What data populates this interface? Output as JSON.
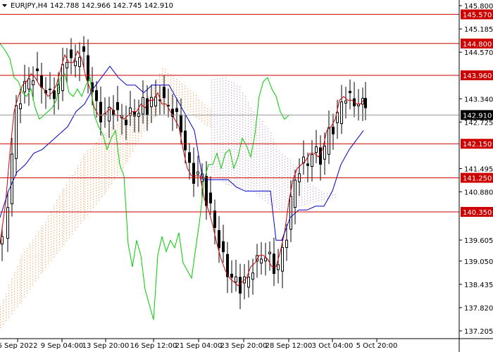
{
  "header": {
    "symbol": "EURJPY,H4",
    "ohlc": "142.788 142.966 142.745 142.910"
  },
  "chart_data": {
    "type": "candlestick",
    "symbol": "EURJPY",
    "timeframe": "H4",
    "open": 142.788,
    "high": 142.966,
    "low": 142.745,
    "close": 142.91,
    "current_price": 142.91,
    "ylim": [
      137.0,
      145.95
    ],
    "y_ticks": [
      "145.800",
      "145.185",
      "144.570",
      "143.340",
      "142.725",
      "141.495",
      "140.880",
      "139.605",
      "139.050",
      "138.435",
      "137.820",
      "137.205"
    ],
    "x_ticks": [
      "6 Sep 2022",
      "9 Sep 04:00",
      "13 Sep 20:00",
      "16 Sep 12:00",
      "21 Sep 04:00",
      "23 Sep 20:00",
      "28 Sep 12:00",
      "3 Oct 04:00",
      "5 Oct 20:00"
    ],
    "levels": [
      145.57,
      144.8,
      143.96,
      142.15,
      141.25,
      140.35
    ],
    "level_labels": [
      "145.570",
      "144.800",
      "143.960",
      "142.150",
      "141.250",
      "140.350"
    ],
    "price_label": "142.910",
    "colors": {
      "level_line": "#cc0000",
      "level_label_bg": "#cc0000",
      "price_label_bg": "#000000",
      "candle": "#000000",
      "tenkan": "#cc0000",
      "kijun": "#0000cc",
      "chikou": "#00cc00",
      "cloud_bull": "#f4a460",
      "cloud_bear": "#c8a2c8"
    },
    "series": [
      {
        "name": "tenkan",
        "x": [
          0,
          8,
          14,
          20,
          26,
          32,
          38,
          44,
          50,
          56,
          62,
          68,
          74,
          80,
          86,
          92,
          98,
          104,
          110,
          116,
          122,
          128,
          134,
          140,
          146,
          152,
          158,
          164,
          170,
          176,
          182,
          188,
          194,
          200,
          206,
          212,
          218,
          224,
          230,
          236,
          242,
          248,
          254,
          260,
          266,
          272,
          278,
          284,
          290,
          296,
          302,
          308,
          314,
          320,
          326,
          332,
          338,
          344,
          350,
          356,
          362,
          368,
          374,
          380,
          386,
          392,
          398,
          404,
          410,
          416,
          422,
          428,
          434,
          440,
          446,
          452,
          458,
          464,
          470,
          476,
          482,
          488,
          494,
          500,
          506,
          512,
          516
        ],
        "y": [
          139.5,
          140.6,
          141.9,
          143.0,
          143.4,
          143.7,
          143.8,
          144.0,
          143.9,
          143.7,
          143.6,
          143.4,
          143.5,
          143.7,
          144.1,
          144.5,
          144.3,
          144.3,
          144.6,
          144.4,
          143.9,
          143.6,
          143.1,
          142.9,
          142.9,
          143.0,
          143.1,
          142.9,
          142.9,
          142.8,
          142.9,
          143.0,
          143.0,
          143.2,
          143.1,
          143.3,
          143.3,
          143.5,
          143.2,
          143.2,
          143.0,
          142.8,
          142.6,
          142.0,
          141.5,
          141.3,
          141.3,
          141.3,
          140.7,
          140.4,
          140.0,
          139.5,
          139.1,
          138.8,
          138.6,
          138.5,
          138.4,
          138.5,
          138.6,
          138.9,
          139.0,
          139.2,
          139.2,
          139.1,
          138.9,
          138.9,
          139.3,
          139.8,
          140.6,
          141.2,
          141.5,
          141.6,
          141.7,
          141.9,
          141.9,
          141.8,
          142.0,
          142.5,
          142.6,
          142.8,
          143.3,
          143.4,
          143.3,
          143.3,
          143.2,
          143.2,
          143.3
        ]
      },
      {
        "name": "kijun",
        "x": [
          0,
          12,
          24,
          36,
          48,
          60,
          72,
          84,
          96,
          108,
          120,
          132,
          144,
          156,
          168,
          180,
          192,
          204,
          216,
          228,
          240,
          252,
          264,
          276,
          288,
          300,
          312,
          324,
          336,
          348,
          360,
          372,
          384,
          392,
          400,
          412,
          424,
          436,
          448,
          460,
          472,
          484,
          496,
          508,
          516
        ],
        "y": [
          140.2,
          140.9,
          141.4,
          141.6,
          141.9,
          142.0,
          142.2,
          142.4,
          142.6,
          143.0,
          143.2,
          143.6,
          143.9,
          144.2,
          143.9,
          143.7,
          143.7,
          143.5,
          143.7,
          143.7,
          143.7,
          143.3,
          142.9,
          142.5,
          141.2,
          141.2,
          141.2,
          141.2,
          141.0,
          140.9,
          140.9,
          140.9,
          140.9,
          139.6,
          139.6,
          140.2,
          140.4,
          140.4,
          140.5,
          140.5,
          140.9,
          141.6,
          142.0,
          142.3,
          142.5
        ]
      },
      {
        "name": "chikou",
        "x": [
          0,
          8,
          14,
          20,
          26,
          32,
          38,
          44,
          50,
          56,
          62,
          68,
          74,
          80,
          86,
          92,
          98,
          104,
          110,
          116,
          122,
          128,
          134,
          140,
          146,
          152,
          158,
          164,
          170,
          176,
          182,
          188,
          194,
          200,
          206,
          212,
          218,
          224,
          230,
          236,
          242,
          248,
          254,
          260,
          266,
          272,
          278,
          284,
          290,
          296,
          302,
          308,
          314,
          320,
          326,
          332,
          338,
          344,
          350,
          356,
          362,
          368,
          374,
          380,
          386,
          392,
          398,
          404,
          410
        ],
        "y": [
          144.8,
          144.6,
          144.4,
          143.9,
          143.8,
          143.5,
          143.4,
          143.6,
          143.1,
          142.8,
          142.9,
          143.0,
          143.1,
          143.3,
          143.9,
          144.0,
          143.5,
          143.4,
          143.6,
          143.4,
          143.7,
          143.9,
          142.9,
          142.6,
          142.4,
          142.0,
          142.3,
          142.5,
          141.6,
          141.3,
          139.5,
          138.9,
          139.6,
          139.2,
          138.3,
          137.9,
          137.5,
          139.2,
          139.7,
          139.3,
          139.6,
          139.4,
          139.8,
          139.0,
          138.8,
          138.6,
          139.4,
          140.2,
          141.2,
          141.6,
          141.6,
          141.9,
          141.5,
          141.9,
          142.0,
          141.5,
          141.8,
          142.3,
          142.1,
          141.8,
          142.4,
          143.4,
          143.8,
          143.9,
          143.6,
          143.4,
          143.0,
          142.8,
          142.9
        ]
      }
    ],
    "cloud_bear": [
      [
        300,
        141.4,
        143.9
      ],
      [
        320,
        141.1,
        143.9
      ],
      [
        340,
        141.0,
        143.7
      ],
      [
        360,
        140.9,
        143.0
      ],
      [
        380,
        140.6,
        142.6
      ],
      [
        400,
        140.4,
        141.9
      ],
      [
        420,
        140.5,
        141.6
      ],
      [
        440,
        140.6,
        141.1
      ],
      [
        460,
        140.7,
        140.9
      ],
      [
        480,
        140.75,
        140.8
      ]
    ],
    "cloud_bull": [
      [
        0,
        137.3,
        137.9
      ],
      [
        30,
        138.0,
        139.2
      ],
      [
        60,
        138.8,
        140.0
      ],
      [
        90,
        139.5,
        141.0
      ],
      [
        120,
        140.2,
        141.9
      ],
      [
        150,
        140.9,
        142.5
      ],
      [
        180,
        141.7,
        142.9
      ],
      [
        210,
        142.7,
        143.4
      ],
      [
        230,
        143.1,
        144.2
      ],
      [
        250,
        143.3,
        143.9
      ],
      [
        270,
        143.0,
        143.6
      ],
      [
        290,
        142.7,
        143.2
      ],
      [
        300,
        142.6,
        143.0
      ]
    ]
  }
}
